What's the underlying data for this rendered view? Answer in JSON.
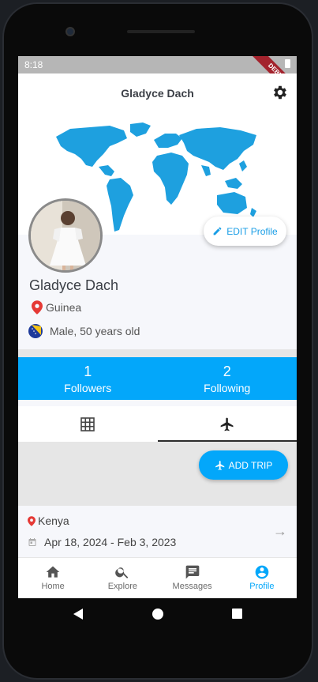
{
  "status": {
    "time": "8:18",
    "debug": "DEBUG"
  },
  "appbar": {
    "title": "Gladyce Dach"
  },
  "profile": {
    "edit_label": "EDIT Profile",
    "name": "Gladyce Dach",
    "location": "Guinea",
    "gender_age": "Male, 50 years old"
  },
  "stats": [
    {
      "num": "1",
      "label": "Followers"
    },
    {
      "num": "2",
      "label": "Following"
    }
  ],
  "tabs": [
    {
      "icon": "grid-icon",
      "active": false
    },
    {
      "icon": "airplane-icon",
      "active": true
    }
  ],
  "add_trip_label": "ADD TRIP",
  "trip": {
    "place": "Kenya",
    "dates": "Apr 18, 2024 - Feb 3, 2023"
  },
  "nav": [
    {
      "label": "Home",
      "icon": "home-icon"
    },
    {
      "label": "Explore",
      "icon": "search-icon"
    },
    {
      "label": "Messages",
      "icon": "message-icon"
    },
    {
      "label": "Profile",
      "icon": "profile-icon"
    }
  ],
  "colors": {
    "accent": "#03a7fa",
    "map": "#1ea0df",
    "pin": "#e53935"
  }
}
